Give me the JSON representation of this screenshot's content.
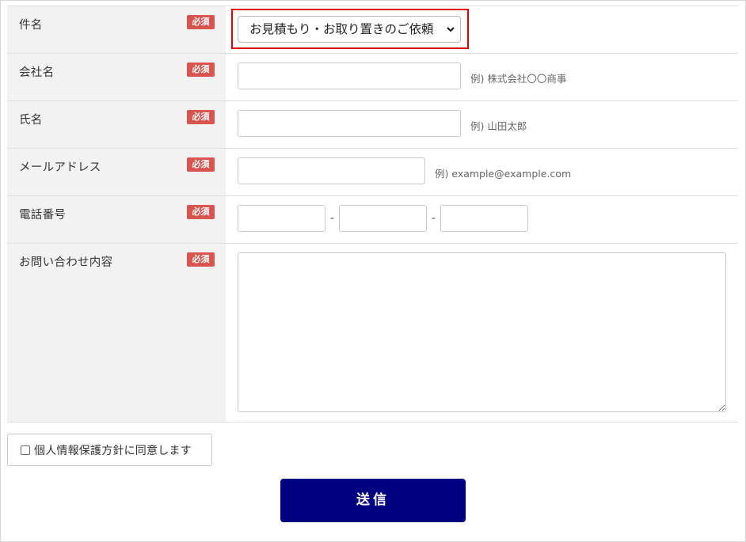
{
  "form": {
    "required_badge": "必須",
    "rows": [
      {
        "label": "件名"
      },
      {
        "label": "会社名",
        "example": "例) 株式会社〇〇商事"
      },
      {
        "label": "氏名",
        "example": "例) 山田太郎"
      },
      {
        "label": "メールアドレス",
        "example": "例) example@example.com"
      },
      {
        "label": "電話番号",
        "separator": "-"
      },
      {
        "label": "お問い合わせ内容"
      }
    ],
    "subject_select": {
      "selected": "お見積もり・お取り置きのご依頼",
      "arrow_icon": "chevron-down-icon"
    },
    "highlight_color": "#e00000"
  },
  "agreement": {
    "label": "個人情報保護方針に同意します",
    "checked": false
  },
  "submit": {
    "label": "送信",
    "color": "#000080"
  }
}
